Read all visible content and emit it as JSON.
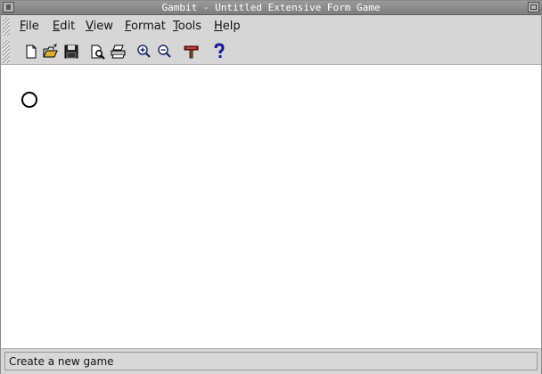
{
  "window": {
    "title": "Gambit - Untitled Extensive Form Game"
  },
  "menubar": {
    "items": [
      {
        "label": "File"
      },
      {
        "label": "Edit"
      },
      {
        "label": "View"
      },
      {
        "label": "Format"
      },
      {
        "label": "Tools"
      },
      {
        "label": "Help"
      }
    ]
  },
  "toolbar": {
    "buttons": [
      {
        "icon": "new-document-icon"
      },
      {
        "icon": "open-folder-icon"
      },
      {
        "icon": "save-disk-icon"
      },
      {
        "icon": "print-preview-icon"
      },
      {
        "icon": "print-icon"
      },
      {
        "icon": "zoom-in-icon"
      },
      {
        "icon": "zoom-out-icon"
      },
      {
        "icon": "tool-icon"
      },
      {
        "icon": "help-icon"
      }
    ]
  },
  "canvas": {
    "root_node": "empty-node"
  },
  "statusbar": {
    "text": "Create a new game"
  },
  "colors": {
    "window_bg": "#d6d6d6",
    "canvas_bg": "#ffffff",
    "titlebar": "#8a8a8a",
    "help_icon": "#1a1a9a",
    "folder_icon": "#e0b030"
  }
}
